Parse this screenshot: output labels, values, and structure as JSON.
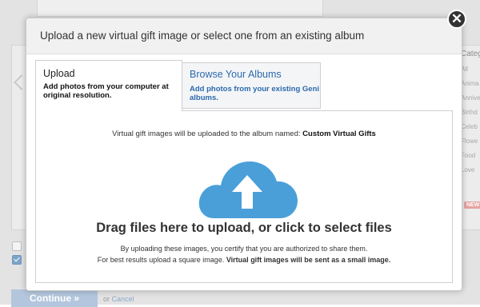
{
  "background": {
    "categories_title": "Categ",
    "categories": [
      "All",
      "Anima",
      "Annive",
      "Birthd",
      "Celeb",
      "Flowe",
      "Food",
      "Love"
    ],
    "new_badge": "NEW",
    "continue_label": "Continue »",
    "or_text": "or",
    "cancel_label": "Cancel"
  },
  "modal": {
    "title": "Upload a new virtual gift image or select one from an existing album",
    "close_symbol": "✕",
    "tabs": [
      {
        "label": "Upload",
        "description": "Add photos from your computer at original resolution.",
        "active": true
      },
      {
        "label": "Browse Your Albums",
        "description": "Add photos from your existing Geni albums.",
        "active": false
      }
    ],
    "dropzone": {
      "album_prefix": "Virtual gift images will be uploaded to the album named:",
      "album_name": "Custom Virtual Gifts",
      "drag_title": "Drag files here to upload, or click to select files",
      "certify_text": "By uploading these images, you certify that you are authorized to share them.",
      "best_results_text": "For best results upload a square image.",
      "best_results_bold": "Virtual gift images will be sent as a small image."
    }
  },
  "colors": {
    "cloud": "#4a9fd9",
    "link_blue": "#2b6aad",
    "overlay": "#e3e3e3"
  },
  "icons": {
    "close": "close-icon",
    "cloud_upload": "cloud-upload-icon"
  }
}
